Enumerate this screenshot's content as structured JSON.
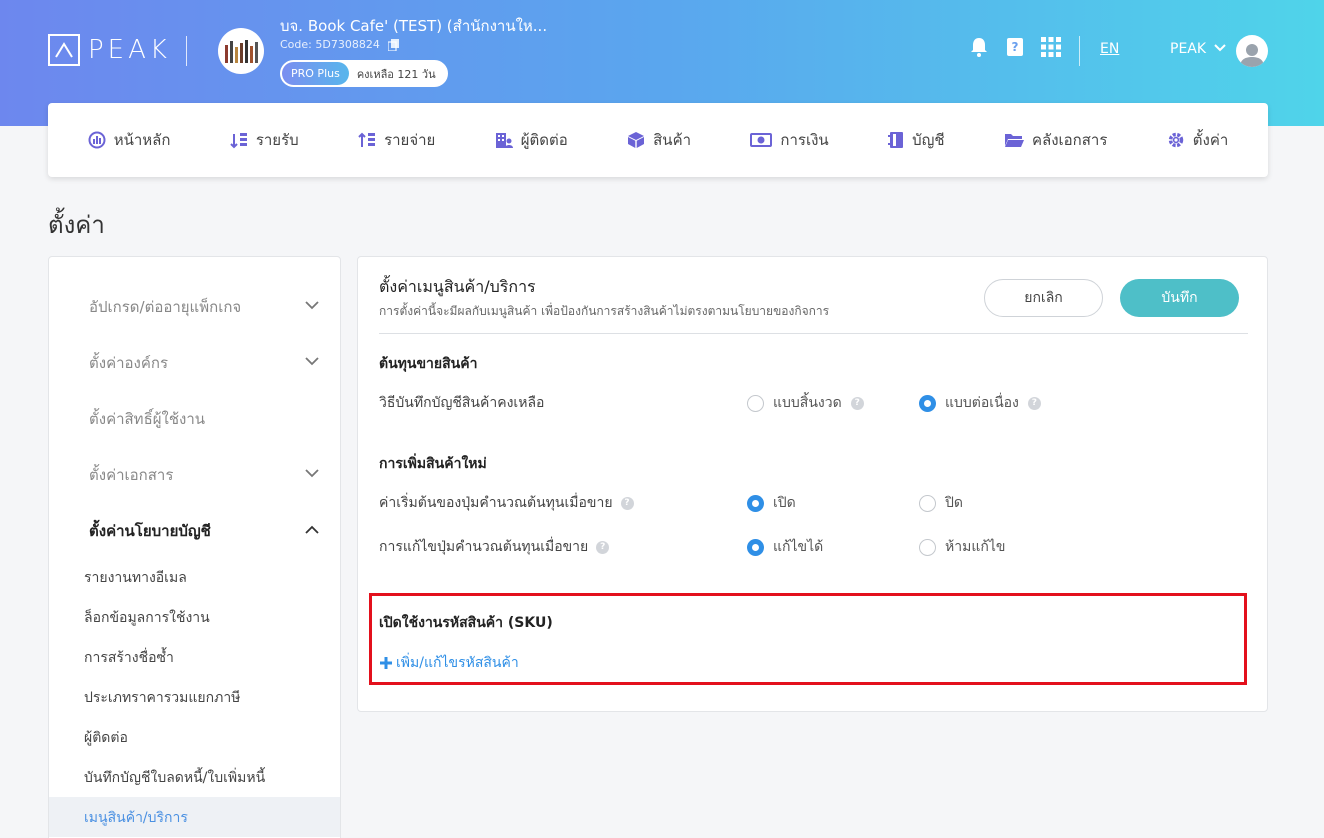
{
  "brand": {
    "logo_text": "PEAK"
  },
  "company": {
    "name": "บจ. Book Cafe' (TEST) (สำนักงานให...",
    "code": "Code: 5D7308824",
    "plan_badge": "PRO Plus",
    "plan_days": "คงเหลือ 121 วัน"
  },
  "header": {
    "lang": "EN",
    "user_name": "PEAK"
  },
  "nav": {
    "items": [
      {
        "label": "หน้าหลัก",
        "icon": "dashboard-icon"
      },
      {
        "label": "รายรับ",
        "icon": "income-icon"
      },
      {
        "label": "รายจ่าย",
        "icon": "expense-icon"
      },
      {
        "label": "ผู้ติดต่อ",
        "icon": "contacts-icon"
      },
      {
        "label": "สินค้า",
        "icon": "box-icon"
      },
      {
        "label": "การเงิน",
        "icon": "money-icon"
      },
      {
        "label": "บัญชี",
        "icon": "book-icon"
      },
      {
        "label": "คลังเอกสาร",
        "icon": "folder-icon"
      },
      {
        "label": "ตั้งค่า",
        "icon": "gear-icon"
      }
    ]
  },
  "page": {
    "title": "ตั้งค่า"
  },
  "sidebar": {
    "groups": [
      {
        "label": "อัปเกรด/ต่ออายุแพ็กเกจ"
      },
      {
        "label": "ตั้งค่าองค์กร"
      },
      {
        "label": "ตั้งค่าสิทธิ์ผู้ใช้งาน"
      },
      {
        "label": "ตั้งค่าเอกสาร"
      },
      {
        "label": "ตั้งค่านโยบายบัญชี"
      }
    ],
    "subitems": [
      {
        "label": "รายงานทางอีเมล"
      },
      {
        "label": "ล็อกข้อมูลการใช้งาน"
      },
      {
        "label": "การสร้างชื่อซ้ำ"
      },
      {
        "label": "ประเภทราคารวมแยกภาษี"
      },
      {
        "label": "ผู้ติดต่อ"
      },
      {
        "label": "บันทึกบัญชีใบลดหนี้/ใบเพิ่มหนี้"
      },
      {
        "label": "เมนูสินค้า/บริการ"
      }
    ]
  },
  "panel": {
    "title": "ตั้งค่าเมนูสินค้า/บริการ",
    "subtitle": "การตั้งค่านี้จะมีผลกับเมนูสินค้า เพื่อป้องกันการสร้างสินค้าไม่ตรงตามนโยบายของกิจการ",
    "cancel_label": "ยกเลิก",
    "save_label": "บันทึก",
    "cost_section": {
      "title": "ต้นทุนขายสินค้า",
      "row_label": "วิธีบันทึกบัญชีสินค้าคงเหลือ",
      "opt_periodic": "แบบสิ้นงวด",
      "opt_perpetual": "แบบต่อเนื่อง",
      "selected": "แบบต่อเนื่อง"
    },
    "new_product_section": {
      "title": "การเพิ่มสินค้าใหม่",
      "row1_label": "ค่าเริ่มต้นของปุ่มคำนวณต้นทุนเมื่อขาย",
      "row1_opt_on": "เปิด",
      "row1_opt_off": "ปิด",
      "row1_selected": "เปิด",
      "row2_label": "การแก้ไขปุ่มคำนวณต้นทุนเมื่อขาย",
      "row2_opt_edit": "แก้ไขได้",
      "row2_opt_noedit": "ห้ามแก้ไข",
      "row2_selected": "แก้ไขได้"
    },
    "sku_section": {
      "title": "เปิดใช้งานรหัสสินค้า (SKU)",
      "link_label": "เพิ่ม/แก้ไขรหัสสินค้า"
    }
  },
  "colors": {
    "accent": "#2f8fe6",
    "save_button": "#4ebfc8",
    "highlight": "#e3101c"
  }
}
